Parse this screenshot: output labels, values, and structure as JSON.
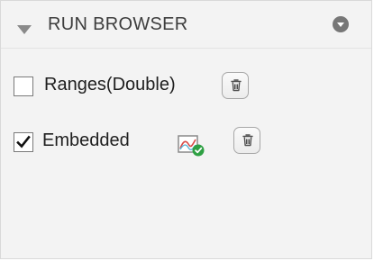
{
  "panel": {
    "title": "RUN BROWSER",
    "icons": {
      "collapse": "collapse-triangle-icon",
      "menu": "menu-circle-icon"
    }
  },
  "runs": [
    {
      "label": "Ranges(Double)",
      "checked": false,
      "delete_icon": "trash-icon"
    },
    {
      "label": "Embedded",
      "checked": true,
      "status_icon": "plot-check-icon",
      "delete_icon": "trash-icon"
    }
  ]
}
